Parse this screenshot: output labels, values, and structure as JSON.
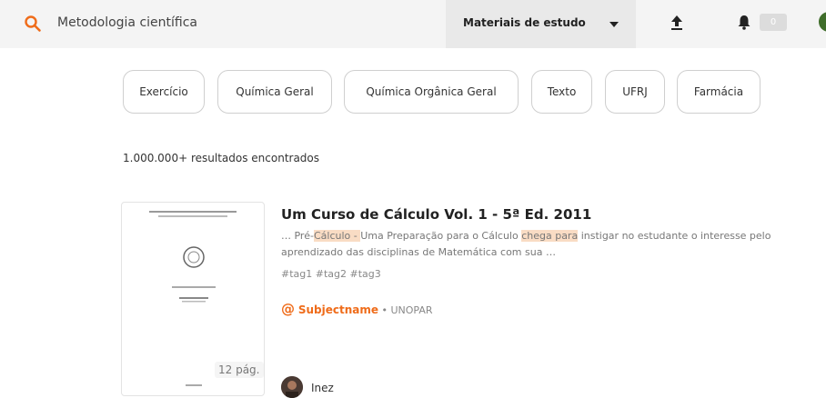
{
  "header": {
    "search_value": "Metodologia científica",
    "filter_label": "Materiais de estudo",
    "notifications_count": "0",
    "accent_color": "#ef6c1a"
  },
  "tags": [
    "Exercício",
    "Química Geral",
    "Química Orgânica Geral",
    "Texto",
    "UFRJ",
    "Farmácia"
  ],
  "results": {
    "count_strong": "1.000.000+",
    "count_rest": " resultados encontrados"
  },
  "result": {
    "title": "Um Curso de Cálculo Vol. 1 - 5ª Ed. 2011",
    "snippet_parts": [
      "… Pré-",
      "Cálculo - ",
      "Uma Preparação para o Cálculo ",
      "chega para",
      " instigar no estudante o interesse pelo"
    ],
    "snippet_line2": "aprendizado das disciplinas de Matemática com sua …",
    "tags_line": "#tag1 #tag2 #tag3",
    "subject": "Subjectname",
    "separator": " • ",
    "institution": "UNOPAR",
    "pages": "12 pág.",
    "user": "Inez"
  },
  "icons": {
    "search": "search-icon",
    "upload": "upload-icon",
    "bell": "bell-icon",
    "at": "at-icon"
  }
}
